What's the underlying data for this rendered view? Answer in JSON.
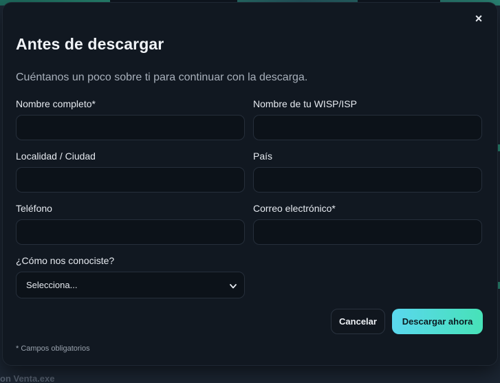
{
  "background": {
    "bottom_text": "on  Venta.exe"
  },
  "modal": {
    "close_glyph": "×",
    "title": "Antes de descargar",
    "subtitle": "Cuéntanos un poco sobre ti para continuar con la descarga.",
    "fields": {
      "nombre": {
        "label": "Nombre completo*",
        "value": ""
      },
      "wisp": {
        "label": "Nombre de tu WISP/ISP",
        "value": ""
      },
      "localidad": {
        "label": "Localidad / Ciudad",
        "value": ""
      },
      "pais": {
        "label": "País",
        "value": ""
      },
      "telefono": {
        "label": "Teléfono",
        "value": ""
      },
      "correo": {
        "label": "Correo electrónico*",
        "value": ""
      },
      "como": {
        "label": "¿Cómo nos conociste?",
        "selected": "Selecciona..."
      }
    },
    "buttons": {
      "cancel": "Cancelar",
      "download": "Descargar ahora"
    },
    "footnote": "* Campos obligatorios"
  },
  "colors": {
    "modal_bg": "#111821",
    "input_bg": "#0c1219",
    "accent_start": "#5ad7ee",
    "accent_end": "#47e2b8"
  },
  "icons": {
    "close": "close-icon",
    "select_arrow": "chevron-down-icon"
  }
}
